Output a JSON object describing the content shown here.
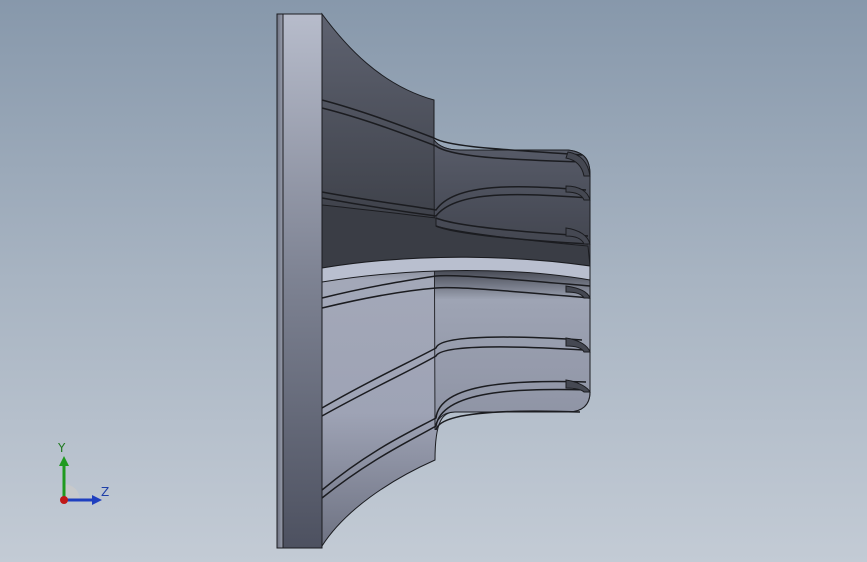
{
  "viewport": {
    "background_top": "#8798ab",
    "background_bottom": "#c3cbd5"
  },
  "model": {
    "description_icon": "turbine-impeller-side-view",
    "face_color": "#8a8f9e",
    "dark_face_color": "#3c3f47",
    "edge_color": "#1b1c20"
  },
  "triad": {
    "y_label": "Y",
    "z_label": "Z",
    "y_color": "#1f9a1f",
    "z_color": "#1f3fbf",
    "x_color": "#c01818"
  }
}
